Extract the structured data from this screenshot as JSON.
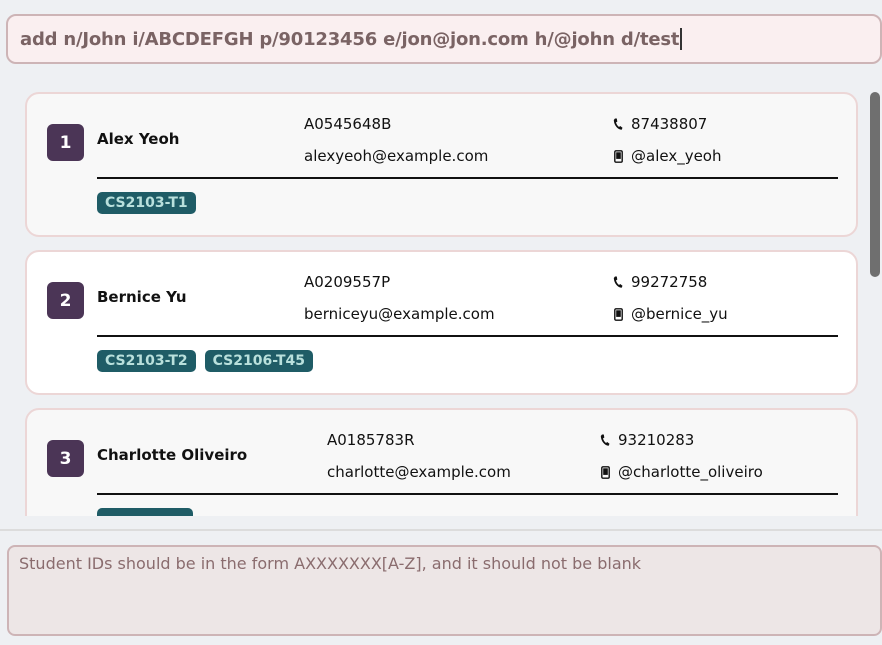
{
  "command": {
    "value": "add n/John i/ABCDEFGH p/90123456 e/jon@jon.com h/@john d/test"
  },
  "students": [
    {
      "index": "1",
      "name": "Alex Yeoh",
      "student_id": "A0545648B",
      "email": "alexyeoh@example.com",
      "phone": "87438807",
      "telegram": "@alex_yeoh",
      "tags": [
        "CS2103-T1"
      ]
    },
    {
      "index": "2",
      "name": "Bernice Yu",
      "student_id": "A0209557P",
      "email": "berniceyu@example.com",
      "phone": "99272758",
      "telegram": "@bernice_yu",
      "tags": [
        "CS2103-T2",
        "CS2106-T45"
      ]
    },
    {
      "index": "3",
      "name": "Charlotte Oliveiro",
      "student_id": "A0185783R",
      "email": "charlotte@example.com",
      "phone": "93210283",
      "telegram": "@charlotte_oliveiro",
      "tags": [
        ""
      ]
    }
  ],
  "result": {
    "message": "Student IDs should be in the form AXXXXXXX[A-Z], and it should not be blank"
  },
  "colors": {
    "index_badge": "#4b3556",
    "tag_bg": "#1f5c66",
    "tag_text": "#b9e0dc",
    "command_bg": "#faeff0",
    "result_text": "#8a6c6e"
  },
  "icons": {
    "phone": "phone-icon",
    "telegram": "mobile-icon"
  }
}
